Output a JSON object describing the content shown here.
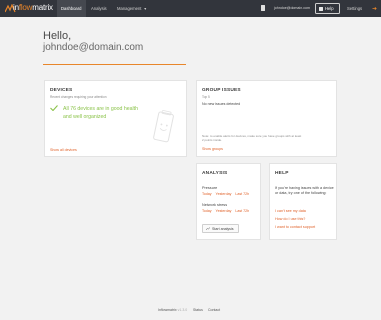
{
  "brand": {
    "part1": "in",
    "part2": "flow",
    "part3": "matrix"
  },
  "nav": {
    "items": [
      {
        "label": "Dashboard",
        "active": true
      },
      {
        "label": "Analysis",
        "active": false
      },
      {
        "label": "Management",
        "active": false
      }
    ],
    "user_email": "johndoe@domain.com",
    "help_label": "Help",
    "settings_label": "Settings"
  },
  "greeting": {
    "hello": "Hello,",
    "email": "johndoe@domain.com"
  },
  "devices": {
    "title": "DEVICES",
    "subtitle": "Recent changes requiring your attention",
    "status": "All 76 devices are in good health and well organized",
    "link": "Show all devices"
  },
  "group_issues": {
    "title": "GROUP ISSUES",
    "subtitle": "Top 5",
    "empty": "No new issues detected",
    "note": "Note: to enable alerts for devices, make sure you have groups with at least 2 points inside.",
    "link": "Show groups"
  },
  "analysis": {
    "title": "ANALYSIS",
    "pressure_label": "Pressure",
    "network_label": "Network stress",
    "periods": [
      "Today",
      "Yesterday",
      "Last 72h"
    ],
    "start_label": "Start analysis"
  },
  "help": {
    "title": "HELP",
    "text": "If you're having issues with a device or data, try one of the following:",
    "links": [
      "I can't see my data",
      "How do I use this?",
      "I want to contact support"
    ]
  },
  "footer": {
    "brand": "Inflowmatrix",
    "version": "v1.3.0",
    "status": "Status",
    "contact": "Contact"
  },
  "colors": {
    "accent": "#e0622a",
    "brand_orange": "#e8862b",
    "ok_green": "#8bc34a",
    "nav_bg": "#32353c"
  }
}
